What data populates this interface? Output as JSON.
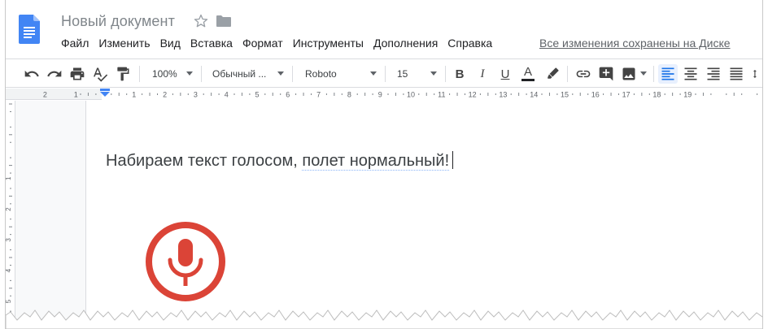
{
  "header": {
    "title": "Новый документ",
    "menu": [
      "Файл",
      "Изменить",
      "Вид",
      "Вставка",
      "Формат",
      "Инструменты",
      "Дополнения",
      "Справка"
    ],
    "saved_status": "Все изменения сохранены на Диске"
  },
  "toolbar": {
    "zoom": "100%",
    "style": "Обычный ...",
    "font": "Roboto",
    "font_size": "15",
    "bold_label": "B",
    "italic_label": "I",
    "underline_label": "U",
    "text_color_label": "A"
  },
  "ruler": {
    "left_labels": [
      "2",
      "1"
    ],
    "labels": [
      "1",
      "2",
      "3",
      "4",
      "5",
      "6",
      "7",
      "8",
      "9",
      "10",
      "11",
      "12",
      "13",
      "14",
      "15",
      "16",
      "17",
      "18",
      "19"
    ],
    "vertical_labels": [
      "1",
      "2",
      "3",
      "4",
      "5"
    ]
  },
  "document": {
    "text_part1": "Набираем текст голосом, ",
    "text_part2": "полет нормальный!"
  },
  "colors": {
    "mic_accent": "#db4437",
    "doc_icon": "#4285f4",
    "active_align_bg": "#e8f0fe"
  },
  "icons": {
    "doc_logo": "google-docs-icon",
    "star": "star-icon",
    "folder": "folder-icon",
    "mic": "microphone-icon"
  }
}
